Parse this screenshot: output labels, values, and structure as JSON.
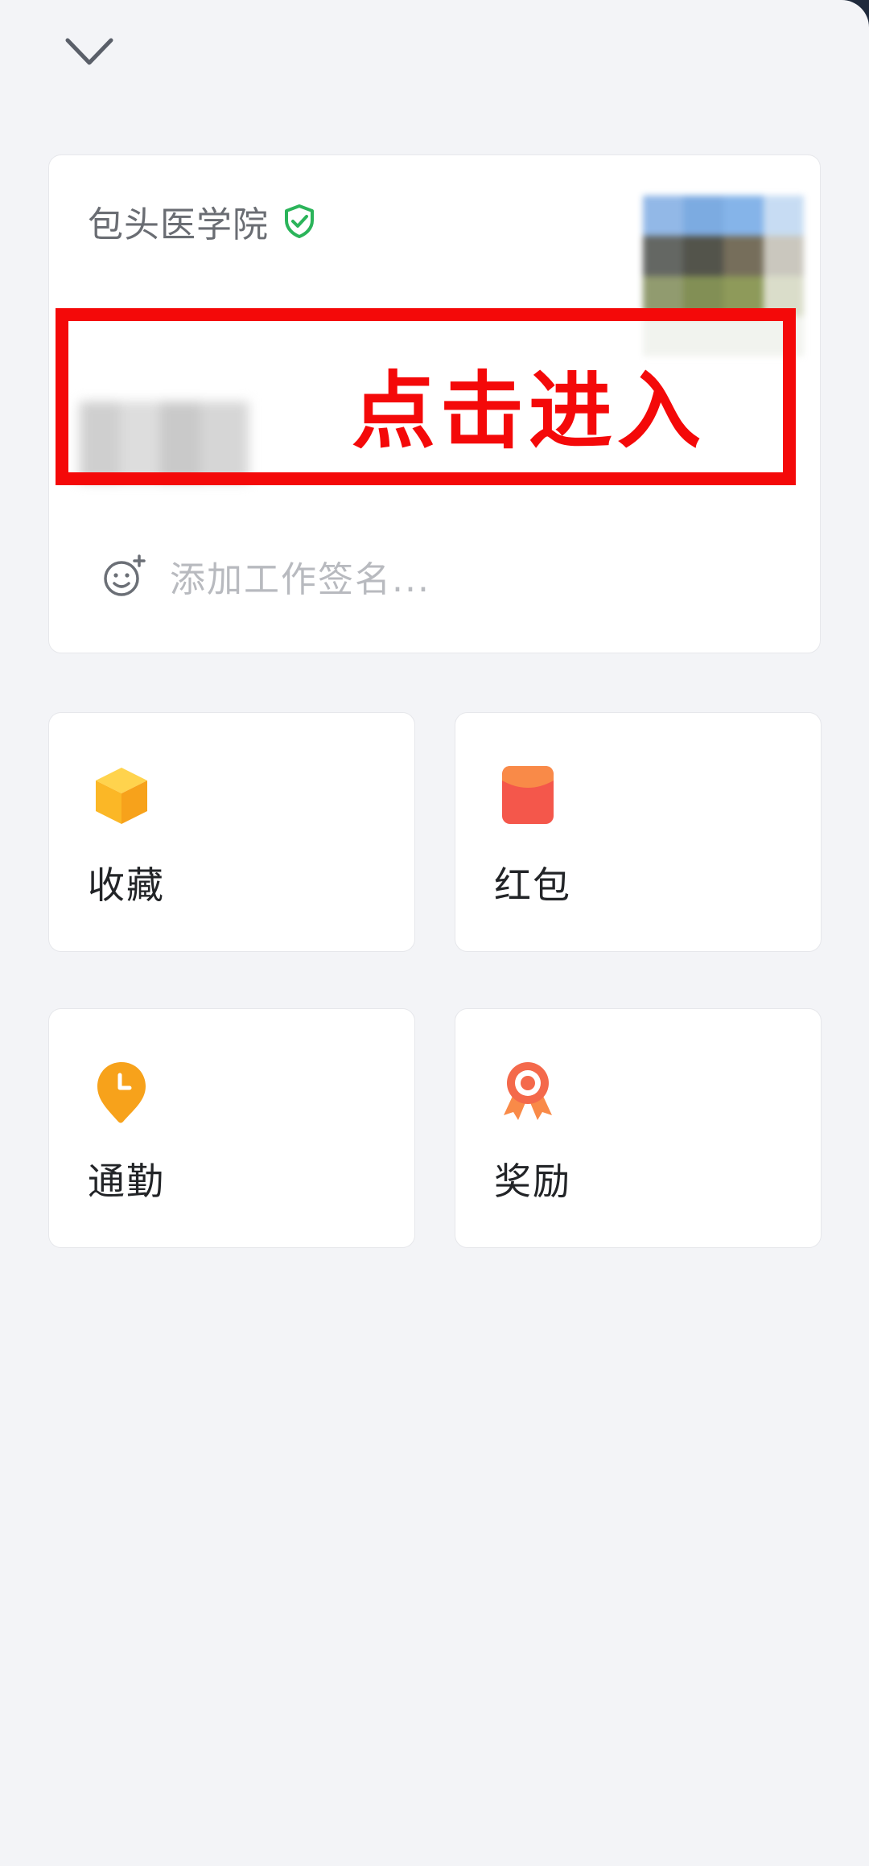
{
  "header": {
    "collapse_icon": "chevron-down-icon"
  },
  "profile": {
    "organization": "包头医学院",
    "verified_icon": "shield-check-icon",
    "avatar": "blurred-profile-photo",
    "name": "",
    "annotation_label": "点击进入",
    "signature_icon": "smile-add-icon",
    "signature_placeholder": "添加工作签名..."
  },
  "tiles": [
    {
      "label": "收藏",
      "icon": "box-icon",
      "color": "#f8b323"
    },
    {
      "label": "红包",
      "icon": "red-envelope-icon",
      "color": "#f4574b"
    },
    {
      "label": "通勤",
      "icon": "clock-pin-icon",
      "color": "#f7a21b"
    },
    {
      "label": "奖励",
      "icon": "medal-icon",
      "color": "#f4694b"
    }
  ],
  "colors": {
    "background": "#f3f4f7",
    "card": "#ffffff",
    "annotation_red": "#f40909",
    "verified_green": "#2bb45a"
  }
}
